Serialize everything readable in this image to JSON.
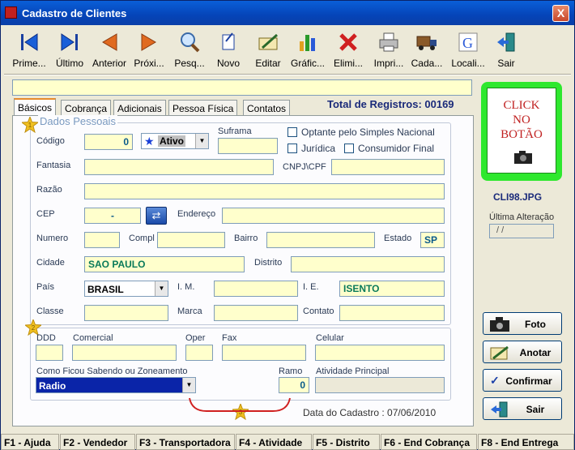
{
  "window": {
    "title": "Cadastro de Clientes",
    "close": "X"
  },
  "toolbar": [
    {
      "label": "Prime...",
      "icon": "first-icon"
    },
    {
      "label": "Último",
      "icon": "last-icon"
    },
    {
      "label": "Anterior",
      "icon": "previous-icon"
    },
    {
      "label": "Próxi...",
      "icon": "next-icon"
    },
    {
      "label": "Pesq...",
      "icon": "search-icon"
    },
    {
      "label": "Novo",
      "icon": "new-icon"
    },
    {
      "label": "Editar",
      "icon": "edit-icon"
    },
    {
      "label": "Gráfic...",
      "icon": "chart-icon"
    },
    {
      "label": "Elimi...",
      "icon": "delete-icon"
    },
    {
      "label": "Impri...",
      "icon": "print-icon"
    },
    {
      "label": "Cada...",
      "icon": "truck-icon"
    },
    {
      "label": "Locali...",
      "icon": "google-icon"
    },
    {
      "label": "Sair",
      "icon": "exit-icon"
    }
  ],
  "tabs": [
    "Básicos",
    "Cobrança",
    "Adicionais",
    "Pessoa Física",
    "Contatos"
  ],
  "total_registros": "Total de Registros: 00169",
  "group_title": "Dados Pessoais",
  "fields": {
    "codigo_label": "Código",
    "codigo": "0",
    "status": "Ativo",
    "suframa_label": "Suframa",
    "simples_label": "Optante pelo Simples Nacional",
    "juridica_label": "Jurídica",
    "consumidor_label": "Consumidor Final",
    "fantasia_label": "Fantasia",
    "cnpj_label": "CNPJ\\CPF",
    "razao_label": "Razão",
    "cep_label": "CEP",
    "cep": "-",
    "endereco_label": "Endereço",
    "numero_label": "Numero",
    "compl_label": "Compl",
    "bairro_label": "Bairro",
    "estado_label": "Estado",
    "estado": "SP",
    "cidade_label": "Cidade",
    "cidade": "SAO PAULO",
    "distrito_label": "Distrito",
    "pais_label": "País",
    "pais": "BRASIL",
    "im_label": "I. M.",
    "ie_label": "I. E.",
    "ie": "ISENTO",
    "classe_label": "Classe",
    "marca_label": "Marca",
    "contato_label": "Contato",
    "ddd_label": "DDD",
    "comercial_label": "Comercial",
    "oper_label": "Oper",
    "fax_label": "Fax",
    "celular_label": "Celular",
    "como_label": "Como Ficou Sabendo ou Zoneamento",
    "como": "Radio",
    "ramo_label": "Ramo",
    "ramo": "0",
    "atividade_label": "Atividade Principal",
    "data_cadastro": "Data do Cadastro : 07/06/2010"
  },
  "badges": [
    "1",
    "2",
    "3"
  ],
  "photo": {
    "text1": "CLICK",
    "text2": "NO",
    "text3": "BOTÃO",
    "filename": "CLI98.JPG",
    "ultima_label": "Última Alteração",
    "ultima": "/ /"
  },
  "buttons": {
    "foto": "Foto",
    "anotar": "Anotar",
    "confirmar": "Confirmar",
    "sair": "Sair"
  },
  "statusbar": [
    "F1 - Ajuda",
    "F2 - Vendedor",
    "F3 - Transportadora",
    "F4 - Atividade",
    "F5 - Distrito",
    "F6 - End Cobrança",
    "F8 - End Entrega"
  ]
}
